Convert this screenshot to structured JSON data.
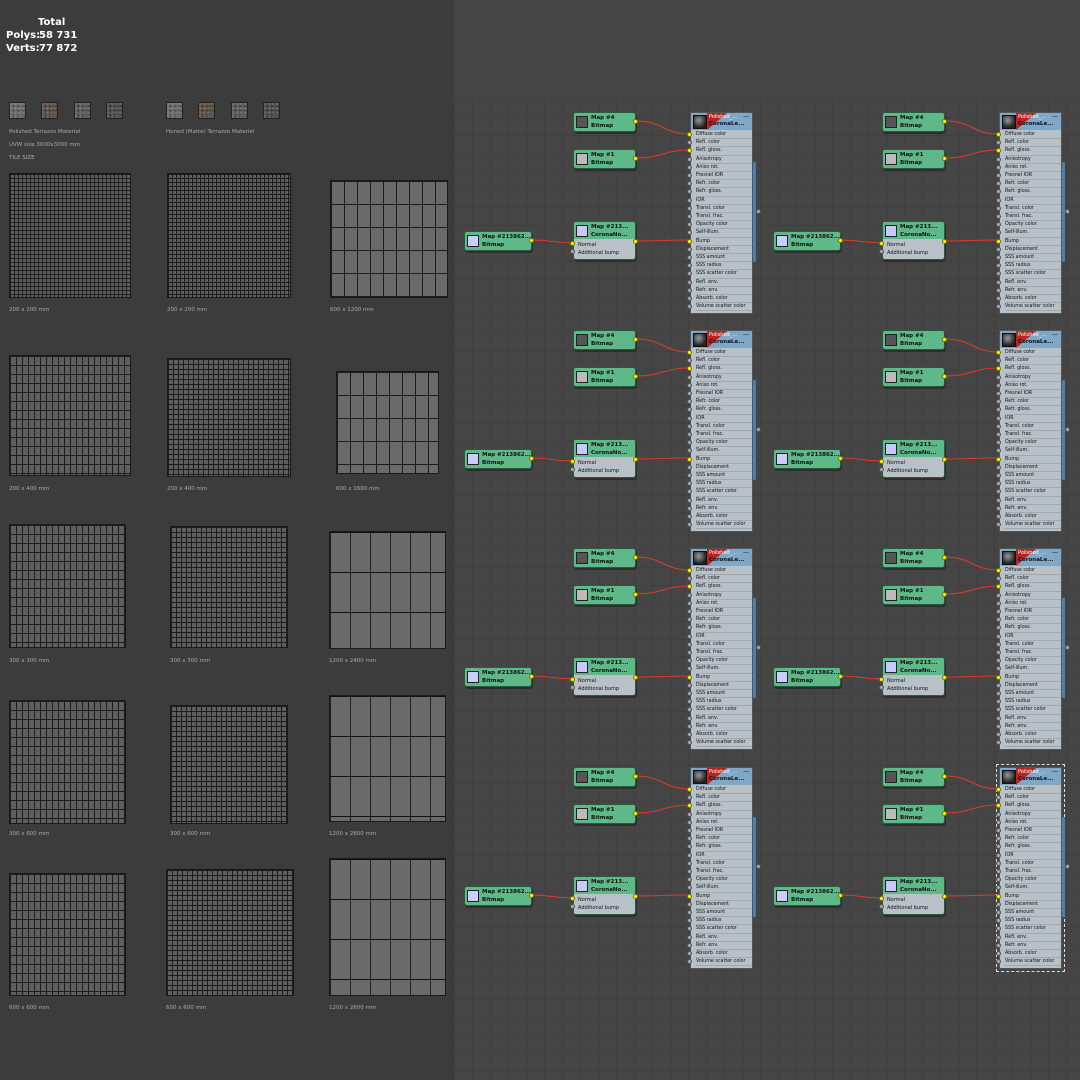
{
  "stats": {
    "total_label": "Total",
    "polys_label": "Polys:",
    "polys_value": "58 731",
    "verts_label": "Verts:",
    "verts_value": "77 872"
  },
  "materials_info": {
    "polished_label": "Polished Terrazzo Materiel",
    "honed_label": "Honed (Matte) Terrazzo Materiel",
    "uvw_label": "UVW size 3000x3000 mm",
    "tile_size_label": "TILE SIZE",
    "swatch_colors": [
      "#6a6a6e",
      "#5a5048",
      "#5a5a5a",
      "#4a4e48",
      "#6a6a6e",
      "#5a5048",
      "#5a5a5a",
      "#4a4e48"
    ]
  },
  "tiles": [
    {
      "label": "200 x 200 mm",
      "pattern": "fine"
    },
    {
      "label": "200 x 200 mm",
      "pattern": "fine"
    },
    {
      "label": "600 x 1200 mm",
      "pattern": "large"
    },
    {
      "label": "200 x 400 mm",
      "pattern": "brick"
    },
    {
      "label": "200 x 400 mm",
      "pattern": "grid"
    },
    {
      "label": "600 x 1600 mm",
      "pattern": "large"
    },
    {
      "label": "300 x 300 mm",
      "pattern": "brick"
    },
    {
      "label": "300 x 300 mm",
      "pattern": "grid"
    },
    {
      "label": "1200 x 2400 mm",
      "pattern": "xlarge"
    },
    {
      "label": "300 x 600 mm",
      "pattern": "brick"
    },
    {
      "label": "300 x 600 mm",
      "pattern": "grid"
    },
    {
      "label": "1200 x 2800 mm",
      "pattern": "xlarge"
    },
    {
      "label": "600 x 600 mm",
      "pattern": "brick"
    },
    {
      "label": "600 x 600 mm",
      "pattern": "grid"
    },
    {
      "label": "1200 x 2600 mm",
      "pattern": "xlarge"
    }
  ],
  "node_editor": {
    "map4": {
      "title": "Map #4",
      "type": "Bitmap"
    },
    "map1": {
      "title": "Map #1",
      "type": "Bitmap"
    },
    "corona_normal": {
      "title": "Map #213...",
      "type": "CoronaNo...",
      "slots": [
        "Normal",
        "Additional bump"
      ]
    },
    "bitmap_src": {
      "title": "Map #213862...",
      "type": "Bitmap"
    },
    "material": {
      "title_top": "Polished_...",
      "title": "CoronaLe...",
      "slots": [
        "Diffuse color",
        "Refl. color",
        "Refl. gloss.",
        "Anisotropy",
        "Aniso rot.",
        "Fresnel IOR",
        "Refr. color",
        "Refr. gloss.",
        "IOR",
        "Transl. color",
        "Transl. frac.",
        "Opacity color",
        "Self-illum.",
        "Bump",
        "Displacement",
        "SSS amount",
        "SSS radius",
        "SSS scatter color",
        "Refl. env.",
        "Refr. env.",
        "Absorb. color",
        "Volume scatter color"
      ]
    }
  }
}
